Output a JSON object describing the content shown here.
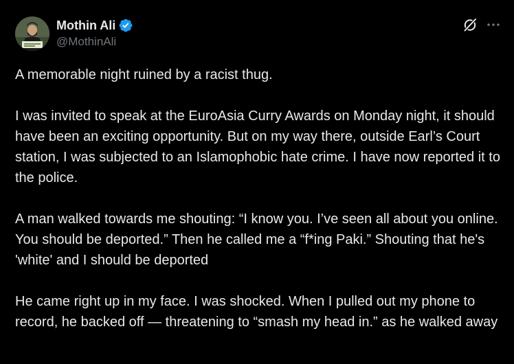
{
  "author": {
    "display_name": "Mothin Ali",
    "handle": "@MothinAli",
    "verified": true,
    "verified_color": "#1d9bf0"
  },
  "icons": {
    "grok": "grok-icon",
    "more": "more-icon",
    "verified": "verified-badge-icon"
  },
  "tweet": {
    "paragraphs": [
      "A memorable night ruined by a racist thug.",
      "I was invited to speak at the EuroAsia Curry Awards on Monday night, it should have been an exciting opportunity. But on my way there, outside Earl’s Court station, I was subjected to an Islamophobic hate crime. I have now reported it to the police.",
      "A man walked towards me shouting: “I know you. I’ve seen all about you online. You should be deported.” Then he called me a “f*ing Paki.” Shouting that he's 'white' and I should be deported",
      "He came right up in my face. I was shocked. When I pulled out my phone to record, he backed off — threatening to “smash my head in.” as he walked away"
    ]
  },
  "colors": {
    "background": "#000000",
    "text": "#e7e9ea",
    "secondary": "#71767b"
  }
}
